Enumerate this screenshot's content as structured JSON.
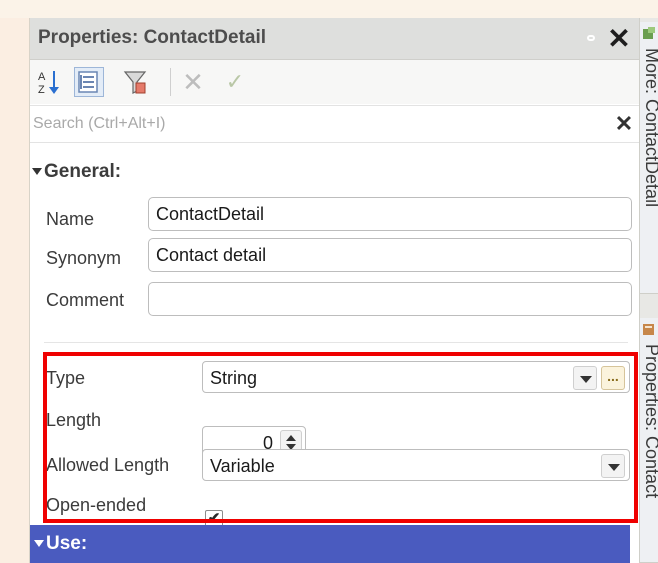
{
  "panel": {
    "title": "Properties: ContactDetail",
    "toolbar": {
      "sort_icon": "sort-az-icon",
      "categories_icon": "categories-icon",
      "filter_icon": "filter-icon",
      "cancel_icon": "x-icon",
      "apply_icon": "check-icon"
    },
    "search": {
      "placeholder": "Search (Ctrl+Alt+I)",
      "value": ""
    },
    "groups": {
      "general": {
        "header": "General:",
        "name_label": "Name",
        "name_value": "ContactDetail",
        "synonym_label": "Synonym",
        "synonym_value": "Contact detail",
        "comment_label": "Comment",
        "comment_value": "",
        "type_label": "Type",
        "type_value": "String",
        "length_label": "Length",
        "length_value": "0",
        "allowed_length_label": "Allowed Length",
        "allowed_length_value": "Variable",
        "open_ended_label": "Open-ended",
        "open_ended_checked": true,
        "check_glyph": "✔"
      },
      "use": {
        "header": "Use:"
      }
    }
  },
  "side_tabs": [
    {
      "label": "More: ContactDetail",
      "icon": "more-tab-icon"
    },
    {
      "label": "Properties: Contact",
      "icon": "properties-tab-icon"
    }
  ],
  "colors": {
    "highlight": "#ef0000",
    "use_bar": "#4a5bbf",
    "title_bar": "#dedfdd"
  }
}
